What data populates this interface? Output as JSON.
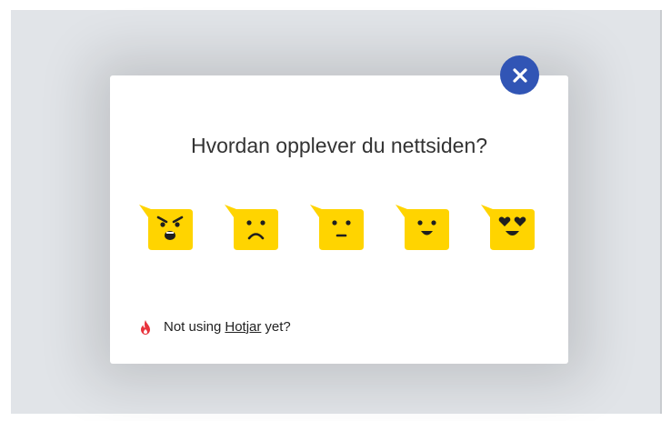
{
  "modal": {
    "title": "Hvordan opplever du nettsiden?",
    "close_icon": "close-icon",
    "emotions": [
      {
        "name": "angry",
        "icon": "angry-face-icon"
      },
      {
        "name": "sad",
        "icon": "sad-face-icon"
      },
      {
        "name": "neutral",
        "icon": "neutral-face-icon"
      },
      {
        "name": "happy",
        "icon": "happy-face-icon"
      },
      {
        "name": "love",
        "icon": "heart-eyes-face-icon"
      }
    ],
    "footer": {
      "prefix": "Not using",
      "link": "Hotjar",
      "suffix": "yet?",
      "icon": "flame-icon"
    }
  },
  "colors": {
    "accent": "#3155b5",
    "emoji": "#ffd400",
    "flame": "#e8333c",
    "backdrop": "#e1e4e8"
  }
}
